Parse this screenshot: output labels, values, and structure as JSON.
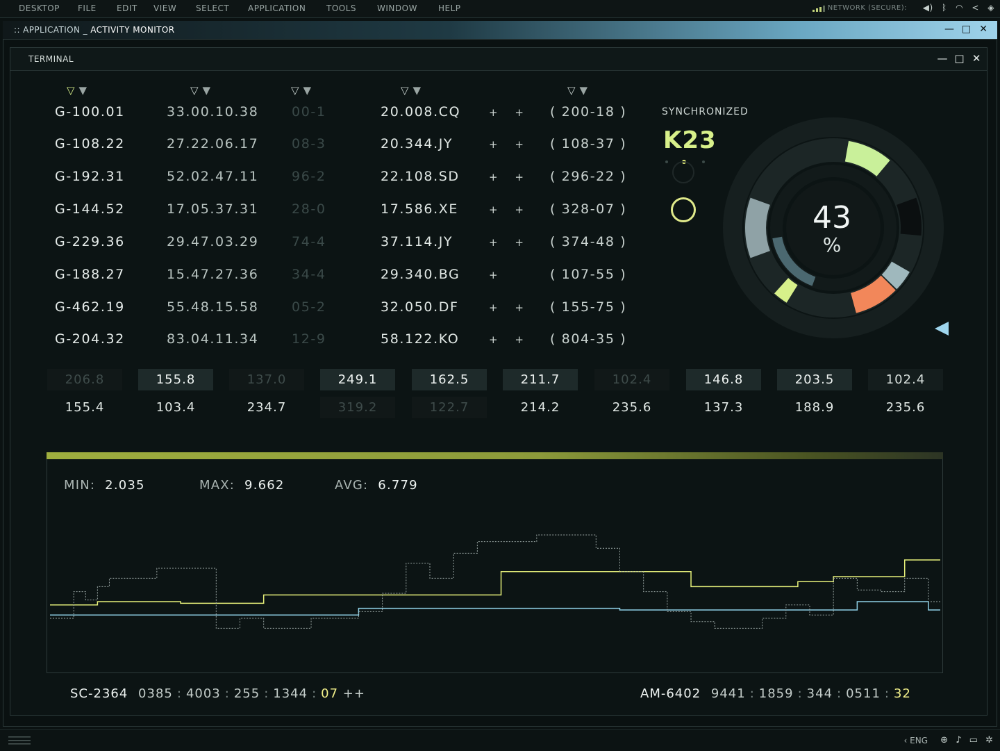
{
  "menubar": {
    "items": [
      "DESKTOP",
      "FILE",
      "EDIT",
      "VIEW",
      "SELECT",
      "APPLICATION",
      "TOOLS",
      "WINDOW",
      "HELP"
    ],
    "network_label": "NETWORK (SECURE):",
    "tray_icons": [
      "volume-icon",
      "bluetooth-icon",
      "wifi-icon",
      "share-icon",
      "shield-icon"
    ]
  },
  "app_window": {
    "prefix": ":: APPLICATION _",
    "title": "ACTIVITY MONITOR"
  },
  "terminal": {
    "title": "TERMINAL",
    "rows": [
      {
        "id": "G-100.01",
        "time": "33.00.10.38",
        "code": "00-1",
        "pair": "20.008.CQ",
        "plus": "+ +",
        "range": "( 200-18 )"
      },
      {
        "id": "G-108.22",
        "time": "27.22.06.17",
        "code": "08-3",
        "pair": "20.344.JY",
        "plus": "+ +",
        "range": "( 108-37 )"
      },
      {
        "id": "G-192.31",
        "time": "52.02.47.11",
        "code": "96-2",
        "pair": "22.108.SD",
        "plus": "+ +",
        "range": "( 296-22 )"
      },
      {
        "id": "G-144.52",
        "time": "17.05.37.31",
        "code": "28-0",
        "pair": "17.586.XE",
        "plus": "+ +",
        "range": "( 328-07 )"
      },
      {
        "id": "G-229.36",
        "time": "29.47.03.29",
        "code": "74-4",
        "pair": "37.114.JY",
        "plus": "+ +",
        "range": "( 374-48 )"
      },
      {
        "id": "G-188.27",
        "time": "15.47.27.36",
        "code": "34-4",
        "pair": "29.340.BG",
        "plus": "+",
        "range": "( 107-55 )"
      },
      {
        "id": "G-462.19",
        "time": "55.48.15.58",
        "code": "05-2",
        "pair": "32.050.DF",
        "plus": "+ +",
        "range": "( 155-75 )"
      },
      {
        "id": "G-204.32",
        "time": "83.04.11.34",
        "code": "12-9",
        "pair": "58.122.KO",
        "plus": "+ +",
        "range": "( 804-35 )"
      }
    ]
  },
  "sync": {
    "label": "SYNCHRONIZED",
    "code": "K23",
    "gauge_value": "43",
    "gauge_unit": "%",
    "gauge_fraction": 0.43
  },
  "value_grid": {
    "row1": [
      {
        "v": "206.8",
        "s": "dm"
      },
      {
        "v": "155.8",
        "s": "hl"
      },
      {
        "v": "137.0",
        "s": "dm"
      },
      {
        "v": "249.1",
        "s": "hl"
      },
      {
        "v": "162.5",
        "s": "hl"
      },
      {
        "v": "211.7",
        "s": "hl"
      },
      {
        "v": "102.4",
        "s": "dm"
      },
      {
        "v": "146.8",
        "s": "hl"
      },
      {
        "v": "203.5",
        "s": "hl"
      },
      {
        "v": "102.4",
        "s": "nm"
      }
    ],
    "row2": [
      {
        "v": "155.4",
        "s": "nm"
      },
      {
        "v": "103.4",
        "s": "nm"
      },
      {
        "v": "234.7",
        "s": "nm"
      },
      {
        "v": "319.2",
        "s": "dm"
      },
      {
        "v": "122.7",
        "s": "dm"
      },
      {
        "v": "214.2",
        "s": "nm"
      },
      {
        "v": "235.6",
        "s": "nm"
      },
      {
        "v": "137.3",
        "s": "nm"
      },
      {
        "v": "188.9",
        "s": "nm"
      },
      {
        "v": "235.6",
        "s": "nm"
      }
    ]
  },
  "stats": {
    "min_label": "MIN:",
    "min": "2.035",
    "max_label": "MAX:",
    "max": "9.662",
    "avg_label": "AVG:",
    "avg": "6.779"
  },
  "chart_data": {
    "type": "line",
    "step": true,
    "grid": false,
    "series": [
      {
        "color": "#e6f07a",
        "style": "solid",
        "values": [
          3.8,
          3.8,
          3.8,
          3.8,
          4.0,
          4.0,
          4.0,
          4.0,
          4.0,
          4.0,
          4.0,
          3.9,
          3.9,
          3.9,
          3.9,
          3.9,
          3.9,
          3.9,
          4.4,
          4.4,
          4.4,
          4.4,
          4.4,
          4.4,
          4.4,
          4.4,
          4.4,
          4.4,
          4.4,
          4.4,
          4.4,
          4.4,
          4.4,
          4.4,
          4.4,
          4.4,
          4.4,
          4.4,
          5.8,
          5.8,
          5.8,
          5.8,
          5.8,
          5.8,
          5.8,
          5.8,
          5.8,
          5.8,
          5.8,
          5.8,
          5.8,
          5.8,
          5.8,
          5.8,
          4.9,
          4.9,
          4.9,
          4.9,
          4.9,
          4.9,
          4.9,
          4.9,
          4.9,
          5.2,
          5.2,
          5.2,
          5.5,
          5.5,
          5.5,
          5.5,
          5.5,
          5.5,
          6.5,
          6.5,
          6.5
        ]
      },
      {
        "color": "#8fd0e6",
        "style": "solid",
        "values": [
          3.2,
          3.2,
          3.2,
          3.2,
          3.2,
          3.2,
          3.2,
          3.2,
          3.2,
          3.2,
          3.2,
          3.2,
          3.2,
          3.2,
          3.2,
          3.2,
          3.2,
          3.2,
          3.2,
          3.2,
          3.2,
          3.2,
          3.2,
          3.2,
          3.2,
          3.2,
          3.6,
          3.6,
          3.6,
          3.6,
          3.6,
          3.6,
          3.6,
          3.6,
          3.6,
          3.6,
          3.6,
          3.6,
          3.6,
          3.6,
          3.6,
          3.6,
          3.6,
          3.6,
          3.6,
          3.6,
          3.6,
          3.6,
          3.5,
          3.5,
          3.5,
          3.5,
          3.5,
          3.5,
          3.5,
          3.5,
          3.5,
          3.5,
          3.5,
          3.5,
          3.5,
          3.5,
          3.5,
          3.5,
          3.5,
          3.5,
          3.5,
          3.5,
          4.0,
          4.0,
          4.0,
          4.0,
          4.0,
          4.0,
          3.5
        ]
      },
      {
        "color": "#9aa6a4",
        "style": "dashed",
        "values": [
          3.0,
          3.0,
          4.6,
          4.1,
          4.9,
          5.4,
          5.4,
          5.4,
          5.4,
          6.0,
          6.0,
          6.0,
          6.0,
          6.0,
          2.4,
          2.4,
          3.0,
          3.0,
          2.4,
          2.4,
          2.4,
          2.4,
          3.0,
          3.0,
          3.0,
          3.0,
          3.4,
          3.4,
          4.5,
          4.5,
          6.3,
          6.3,
          5.4,
          5.4,
          6.9,
          6.9,
          7.6,
          7.6,
          7.6,
          7.6,
          7.6,
          8.0,
          8.0,
          8.0,
          8.0,
          8.0,
          7.2,
          7.2,
          5.8,
          5.8,
          4.6,
          4.6,
          3.4,
          3.4,
          2.8,
          2.8,
          2.4,
          2.4,
          2.4,
          2.4,
          3.0,
          3.0,
          3.8,
          3.8,
          3.2,
          3.2,
          5.4,
          5.4,
          4.7,
          4.7,
          4.6,
          4.6,
          5.4,
          5.4,
          4.0
        ]
      }
    ]
  },
  "footer": {
    "left_label": "SC-2364",
    "left_values": [
      "0385",
      "4003",
      "255",
      "1344"
    ],
    "left_highlight": "07",
    "left_suffix": "++",
    "right_label": "AM-6402",
    "right_values": [
      "9441",
      "1859",
      "344",
      "0511"
    ],
    "right_highlight": "32"
  },
  "taskbar": {
    "lang": "ENG"
  }
}
